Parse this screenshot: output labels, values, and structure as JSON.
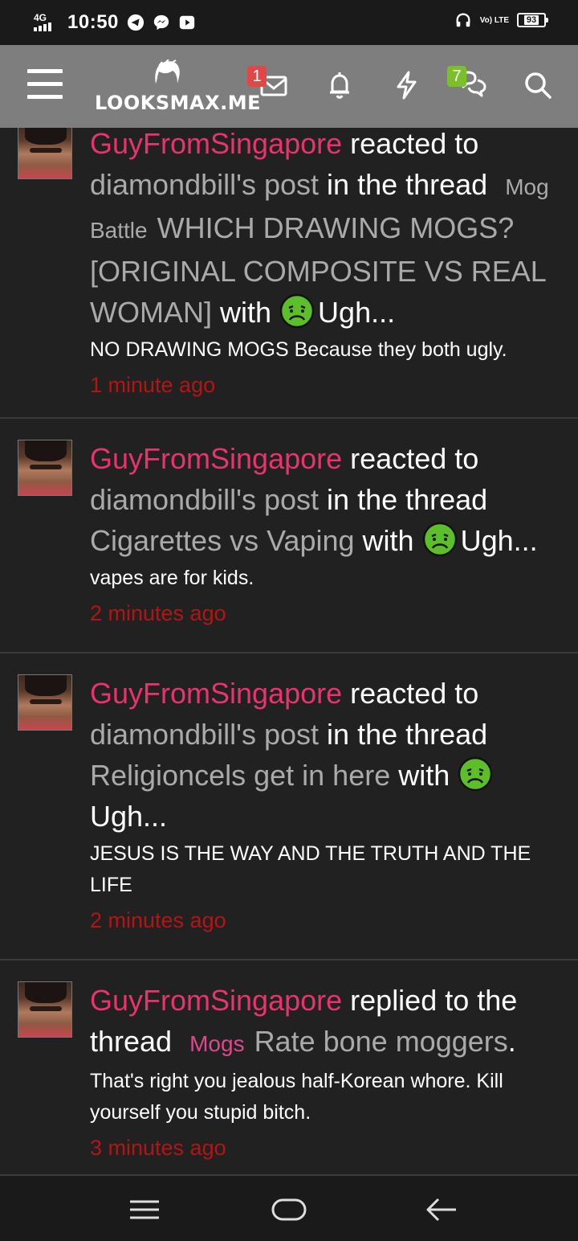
{
  "statusbar": {
    "network": "4G",
    "time": "10:50",
    "lte": "Vo) LTE",
    "battery": "93",
    "icons": [
      "telegram-icon",
      "messenger-icon",
      "youtube-icon",
      "headphones-icon"
    ]
  },
  "header": {
    "logo_text": "LOOKSMAX.ME",
    "inbox_badge": "1",
    "conversations_badge": "7",
    "icons": [
      "menu-icon",
      "inbox-icon",
      "bell-icon",
      "bolt-icon",
      "chat-icon",
      "search-icon"
    ]
  },
  "feed": [
    {
      "user": "GuyFromSingapore",
      "action": "reacted to",
      "post_owner": "diamondbill's post",
      "in_thread": "in the thread",
      "prefix": "Mog Battle",
      "thread_title": "WHICH DRAWING MOGS? [ORIGINAL COMPOSITE VS REAL WOMAN]",
      "with": "with",
      "reaction": "Ugh...",
      "snippet": "NO DRAWING MOGS Because they both ugly.",
      "time": "1 minute ago"
    },
    {
      "user": "GuyFromSingapore",
      "action": "reacted to",
      "post_owner": "diamondbill's post",
      "in_thread": "in the thread",
      "thread_title": "Cigarettes vs Vaping",
      "with": "with",
      "reaction": "Ugh...",
      "snippet": "vapes are for kids.",
      "time": "2 minutes ago"
    },
    {
      "user": "GuyFromSingapore",
      "action": "reacted to",
      "post_owner": "diamondbill's post",
      "in_thread": "in the thread",
      "thread_title": "Religioncels get in here",
      "with": "with",
      "reaction": "Ugh...",
      "snippet": "JESUS IS THE WAY AND THE TRUTH AND THE LIFE",
      "time": "2 minutes ago"
    },
    {
      "user": "GuyFromSingapore",
      "action": "replied to the thread",
      "prefix": "Mogs",
      "thread_title": "Rate bone moggers",
      "snippet": "That's right you jealous half-Korean whore. Kill yourself you stupid bitch.",
      "time": "3 minutes ago"
    }
  ],
  "colors": {
    "username": "#e8336c",
    "link": "#aaaaaa",
    "time": "#b31515",
    "header_bg": "#7e7e7e",
    "page_bg": "#212121"
  }
}
